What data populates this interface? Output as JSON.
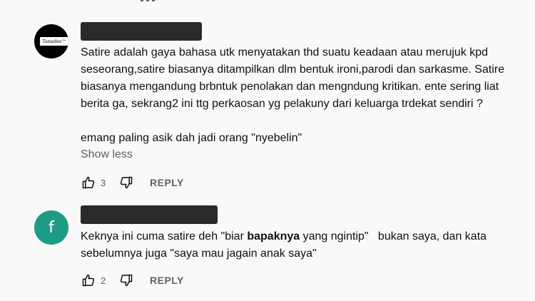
{
  "comments": [
    {
      "avatar_text": "Tamadee™",
      "lines": [
        "Satire adalah gaya bahasa utk menyatakan thd suatu keadaan atau merujuk kpd",
        "seseorang,satire biasanya ditampilkan dlm bentuk ironi,parodi dan sarkasme. Satire",
        "biasanya mengandung brbntuk penolakan dan mengndung kritikan. ente sering liat",
        "berita ga, sekrang2 ini ttg perkaosan yg pelakuny dari keluarga trdekat sendiri ?",
        "emang paling asik dah jadi orang \"nyebelin\""
      ],
      "show_less": "Show less",
      "like_count": "3",
      "reply_label": "REPLY"
    },
    {
      "avatar_letter": "f",
      "avatar_color": "#1e9b86",
      "line1_a": "Keknya ini cuma satire deh \"biar ",
      "line1_bold": "bapaknya",
      "line1_b": " yang ngintip\"   bukan saya, dan kata",
      "line2": "sebelumnya juga \"saya mau jagain anak saya\"",
      "like_count": "2",
      "reply_label": "REPLY"
    }
  ],
  "icons": {
    "like": "thumb-up-icon",
    "dislike": "thumb-down-icon"
  }
}
